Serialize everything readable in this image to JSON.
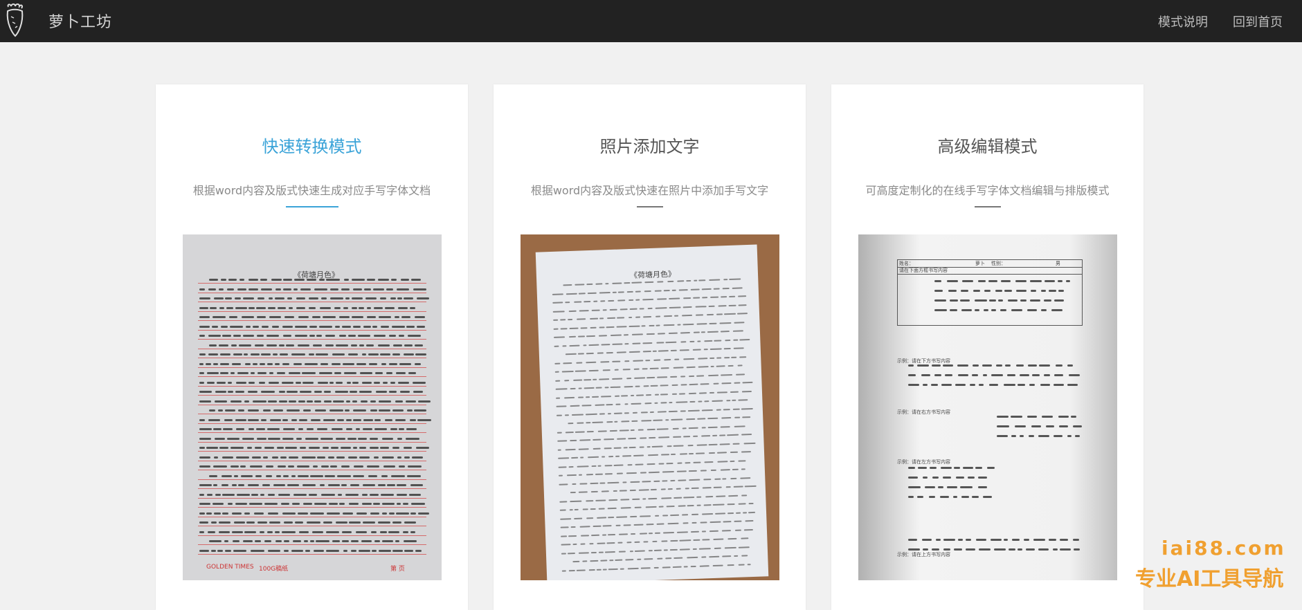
{
  "header": {
    "brand": "萝卜工坊",
    "nav": [
      "模式说明",
      "回到首页"
    ]
  },
  "cards": [
    {
      "title": "快速转换模式",
      "desc": "根据word内容及版式快速生成对应手写字体文档",
      "image": {
        "paper_title": "《荷塘月色》",
        "footer_left": "GOLDEN TIMES",
        "footer_mid": "100G稿纸",
        "footer_right": "第   页"
      }
    },
    {
      "title": "照片添加文字",
      "desc": "根据word内容及版式快速在照片中添加手写文字",
      "image": {
        "paper_title": "《荷塘月色》"
      }
    },
    {
      "title": "高级编辑模式",
      "desc": "可高度定制化的在线手写字体文档编辑与排版模式",
      "image": {
        "form_name_label": "姓名：",
        "form_name_value": "萝卜",
        "form_gender_label": "性别：",
        "form_gender_value": "男",
        "form_note": "请在下面方框书写内容",
        "example1": "示例：请在下方书写内容",
        "example2": "示例：请在右方书写内容",
        "example3": "示例：请在左方书写内容",
        "example4": "示例：请在上方书写内容"
      }
    }
  ],
  "watermark": {
    "domain": "iai88.com",
    "slogan": "专业AI工具导航"
  },
  "colors": {
    "topbar": "#222222",
    "accent": "#3aa3d8",
    "watermark": "#f0a030"
  }
}
